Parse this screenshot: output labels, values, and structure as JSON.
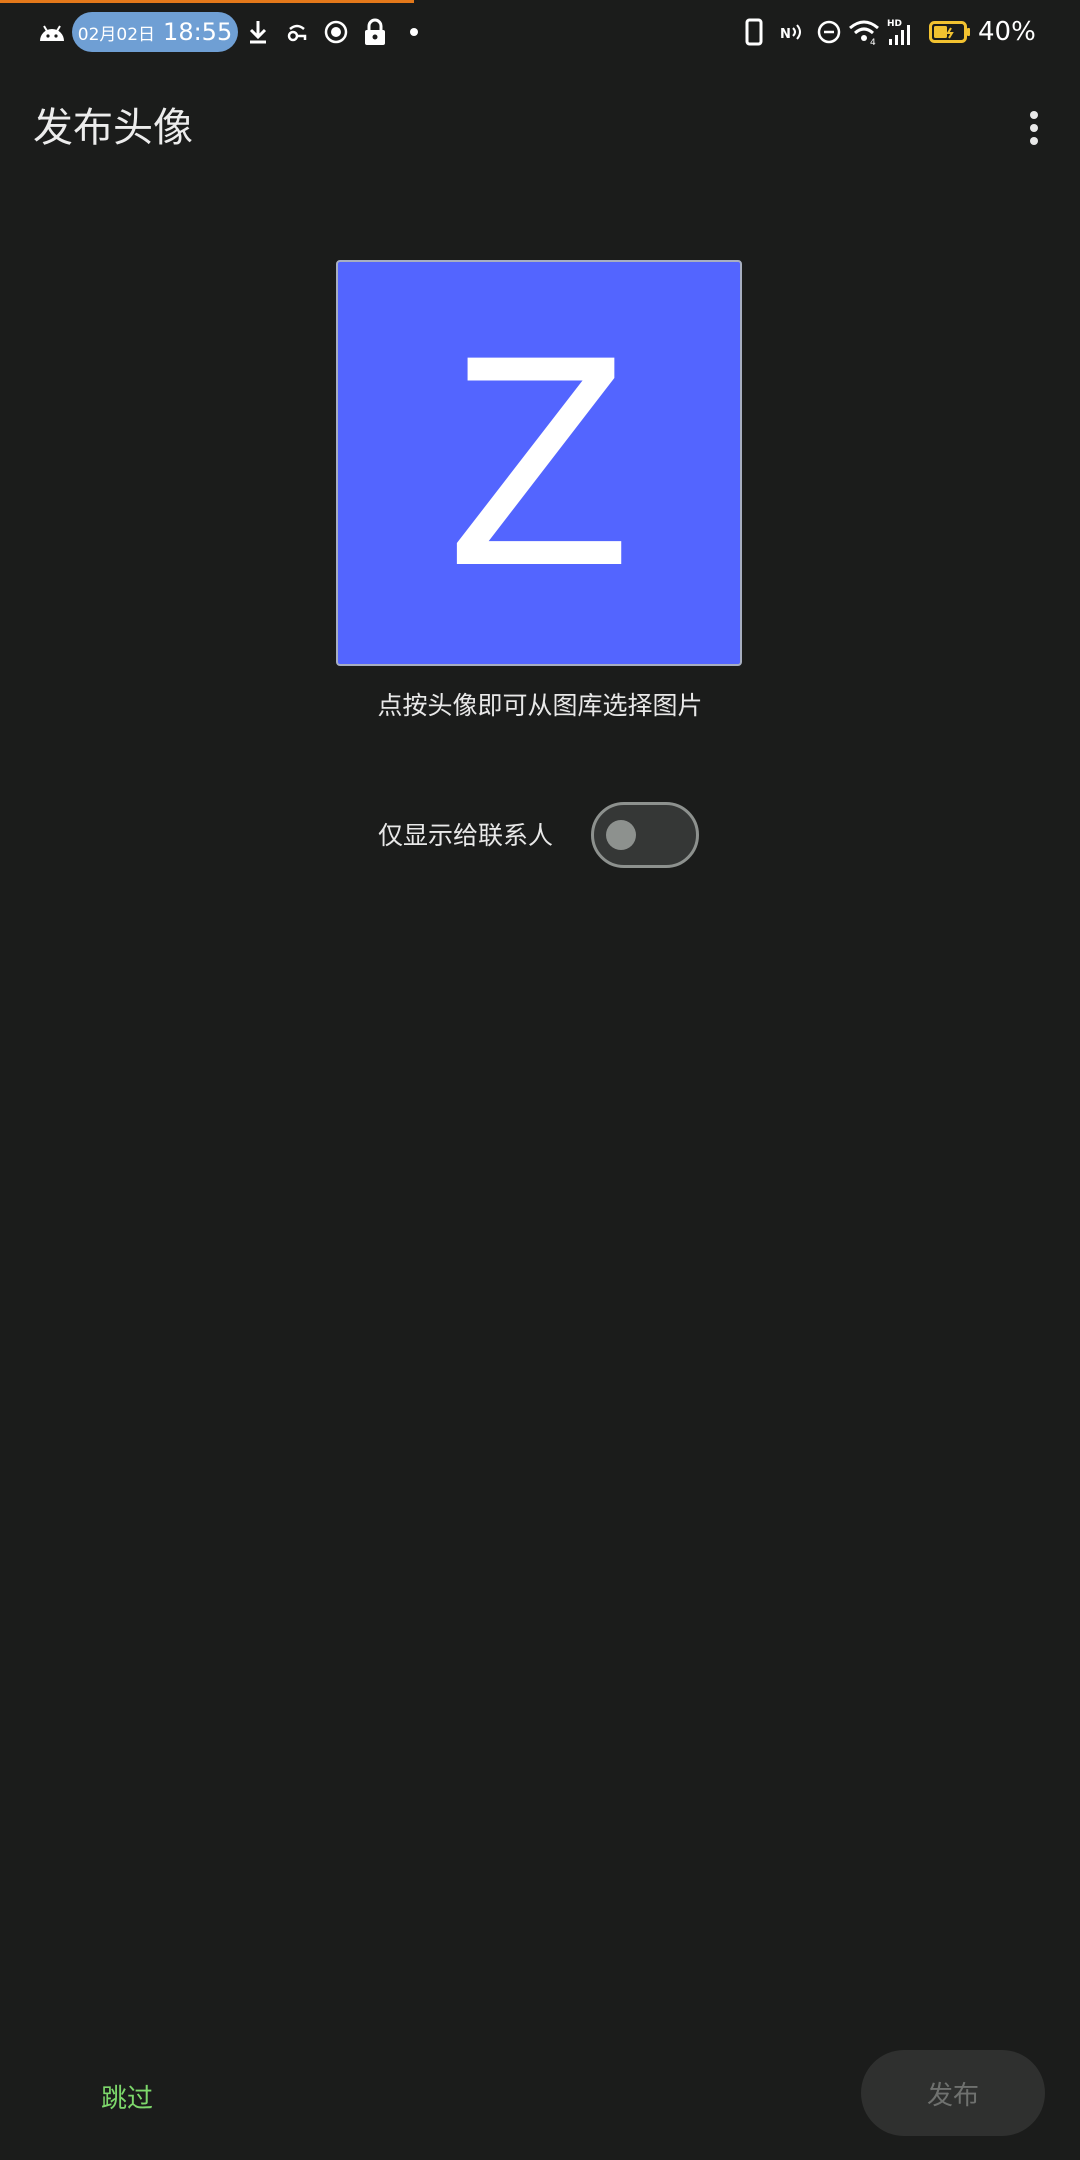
{
  "status_bar": {
    "date": "02月02日",
    "time": "18:55",
    "battery": "40%",
    "icons": [
      "android-icon",
      "download-icon",
      "link-icon",
      "record-icon",
      "lock-icon",
      "dot-icon",
      "phone-icon",
      "nfc-icon",
      "dnd-icon",
      "wifi-icon",
      "signal-icon",
      "battery-icon"
    ],
    "colors": {
      "pill": "#6f9fd4",
      "battery_fill": "#f2c230",
      "progress": "#e3781a"
    }
  },
  "app_bar": {
    "title": "发布头像",
    "menu_icon": "more-vert-icon"
  },
  "avatar": {
    "letter": "Z",
    "background": "#5365ff",
    "hint": "点按头像即可从图库选择图片"
  },
  "visibility_toggle": {
    "label": "仅显示给联系人",
    "checked": false
  },
  "actions": {
    "skip_label": "跳过",
    "publish_label": "发布",
    "skip_color": "#7dd86b"
  }
}
